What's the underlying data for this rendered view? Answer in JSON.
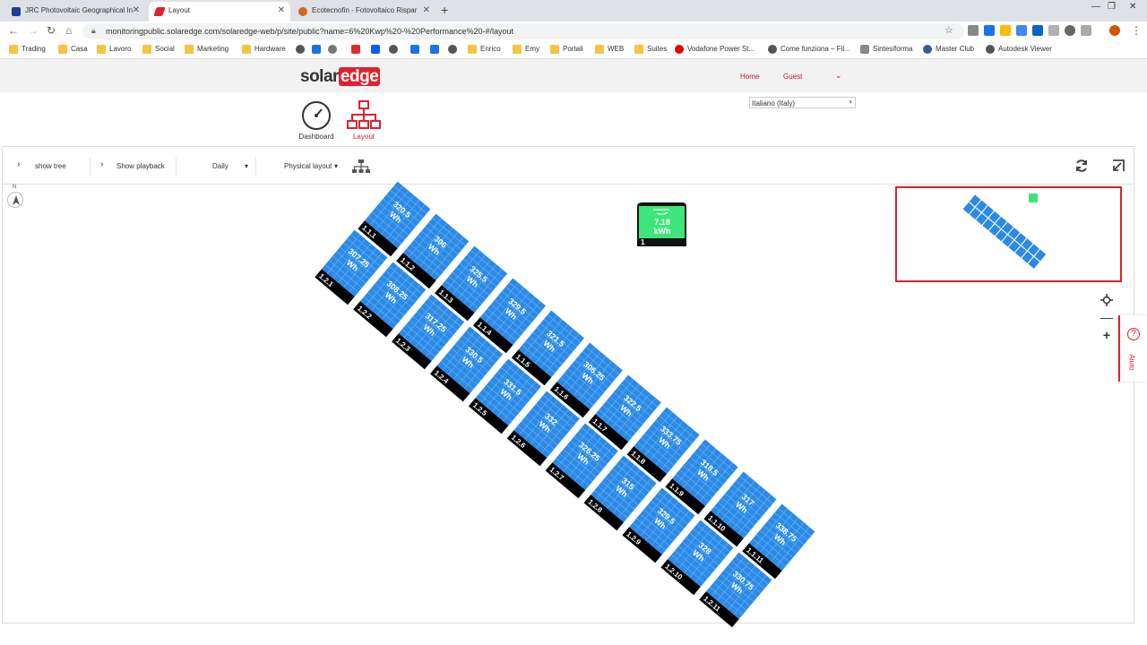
{
  "browser": {
    "tabs": [
      {
        "title": "JRC Photovoltaic Geographical In",
        "active": false
      },
      {
        "title": "Layout",
        "active": true
      },
      {
        "title": "Ecotecnofin - Fotovoltaico Rispar",
        "active": false
      }
    ],
    "new_tab": "+",
    "url": "monitoringpublic.solaredge.com/solaredge-web/p/site/public?name=6%20Kwp%20-%20Performance%20-#/layout",
    "bookmarks": [
      "Trading",
      "Casa",
      "Lavoro",
      "Social",
      "Marketing",
      "Hardware",
      "Enrico",
      "Emy",
      "Portali",
      "WEB",
      "Suites",
      "Vodafone Power St...",
      "Come funziona – Fil...",
      "Sintesiforma",
      "Master Club",
      "Autodesk Viewer"
    ]
  },
  "header": {
    "logo_left": "solar",
    "logo_right": "edge",
    "home": "Home",
    "guest": "Guest"
  },
  "nav": {
    "dashboard": "Dashboard",
    "layout": "Layout"
  },
  "language": "Italiano (Italy)",
  "toolbar": {
    "show_tree": "show tree",
    "show_playback": "Show playback",
    "period": "Daily",
    "layout_mode": "Physical layout"
  },
  "inverter": {
    "value": "7.18",
    "unit": "kWh",
    "id": "1"
  },
  "help_label": "Aiuto",
  "colors": {
    "panel": "#2c8ae6",
    "inverter": "#3de67a",
    "accent": "#e0202e"
  },
  "string1": [
    {
      "id": "1.1.1",
      "value": "320.5"
    },
    {
      "id": "1.1.2",
      "value": "306"
    },
    {
      "id": "1.1.3",
      "value": "325.5"
    },
    {
      "id": "1.1.4",
      "value": "329.5"
    },
    {
      "id": "1.1.5",
      "value": "321.5"
    },
    {
      "id": "1.1.6",
      "value": "306.25"
    },
    {
      "id": "1.1.7",
      "value": "322.5"
    },
    {
      "id": "1.1.8",
      "value": "333.75"
    },
    {
      "id": "1.1.9",
      "value": "318.5"
    },
    {
      "id": "1.1.10",
      "value": "317"
    },
    {
      "id": "1.1.11",
      "value": "338.75"
    }
  ],
  "string2": [
    {
      "id": "1.2.1",
      "value": "307.25"
    },
    {
      "id": "1.2.2",
      "value": "308.25"
    },
    {
      "id": "1.2.3",
      "value": "317.25"
    },
    {
      "id": "1.2.4",
      "value": "330.5"
    },
    {
      "id": "1.2.5",
      "value": "331.5"
    },
    {
      "id": "1.2.6",
      "value": "332"
    },
    {
      "id": "1.2.7",
      "value": "326.25"
    },
    {
      "id": "1.2.8",
      "value": "315"
    },
    {
      "id": "1.2.9",
      "value": "329.5"
    },
    {
      "id": "1.2.10",
      "value": "328"
    },
    {
      "id": "1.2.11",
      "value": "330.75"
    }
  ],
  "panel_unit": "Wh"
}
